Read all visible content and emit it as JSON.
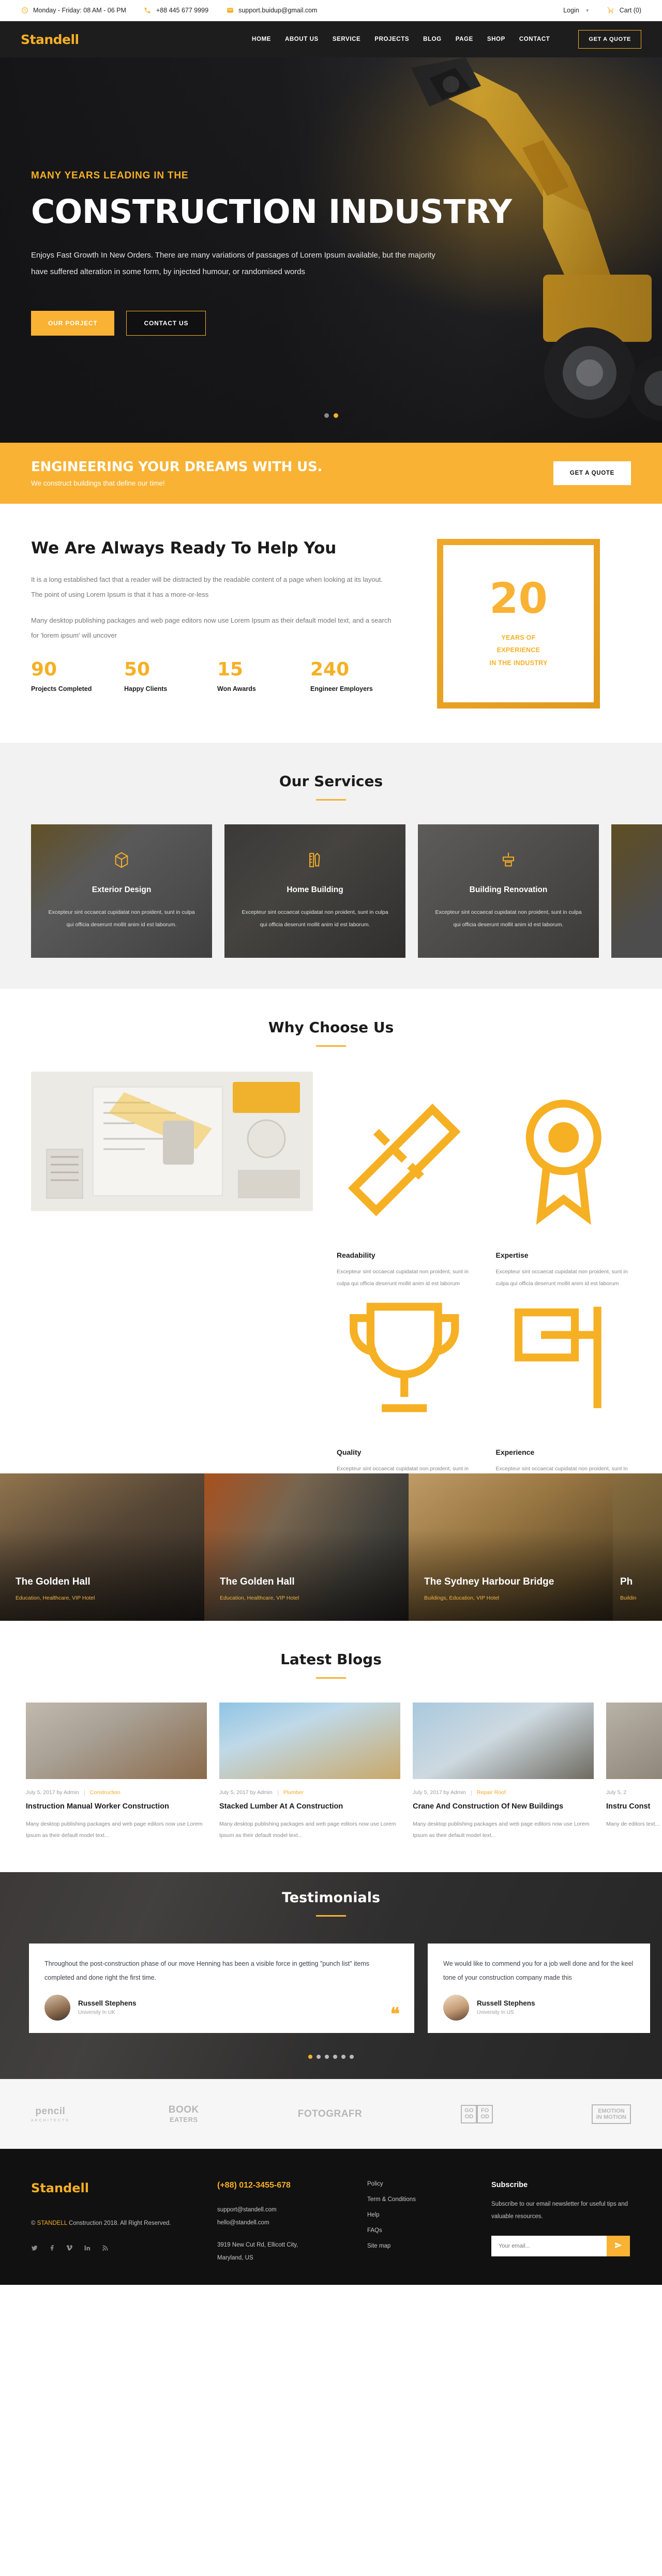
{
  "topbar": {
    "hours": "Monday - Friday: 08 AM - 06 PM",
    "phone": "+88 445 677 9999",
    "email": "support.buidup@gmail.com",
    "login": "Login",
    "cart": "Cart (0)"
  },
  "header": {
    "logo": "Standell",
    "nav": [
      "HOME",
      "ABOUT US",
      "SERVICE",
      "PROJECTS",
      "BLOG",
      "PAGE",
      "SHOP",
      "CONTACT"
    ],
    "quote_button": "GET A QUOTE"
  },
  "hero": {
    "kicker": "MANY YEARS LEADING IN THE",
    "title": "CONSTRUCTION INDUSTRY",
    "subtitle": "Enjoys Fast Growth In New Orders. There are many variations of passages of Lorem Ipsum available, but the majority have suffered alteration in some form, by injected humour, or randomised words",
    "primary_button": "OUR PORJECT",
    "secondary_button": "CONTACT US",
    "slides": 2,
    "active_slide": 1
  },
  "cta": {
    "title": "ENGINEERING YOUR DREAMS WITH US.",
    "subtitle": "We construct buildings that define our time!",
    "button": "GET A QUOTE"
  },
  "ready": {
    "title": "We Are Always Ready To Help You",
    "paragraph1": "It is a long established fact that a reader will be distracted by the readable content of a page when looking at its layout. The point of using Lorem Ipsum is that it has a more-or-less",
    "paragraph2": "Many desktop publishing packages and web page editors now use Lorem Ipsum as their default model text, and a search for 'lorem ipsum' will uncover",
    "stats": [
      {
        "number": "90",
        "label": "Projects Completed"
      },
      {
        "number": "50",
        "label": "Happy Clients"
      },
      {
        "number": "15",
        "label": "Won Awards"
      },
      {
        "number": "240",
        "label": "Engineer Employers"
      }
    ],
    "experience": {
      "number": "20",
      "line1": "YEARS OF",
      "line2": "EXPERIENCE",
      "line3": "IN THE INDUSTRY"
    }
  },
  "services": {
    "title": "Our Services",
    "items": [
      {
        "name": "Exterior Design",
        "desc": "Excepteur sint occaecat cupidatat non proident, sunt in culpa qui officia deserunt mollit anim id est laborum.",
        "icon": "box-icon"
      },
      {
        "name": "Home Building",
        "desc": "Excepteur sint occaecat cupidatat non proident, sunt in culpa qui officia deserunt mollit anim id est laborum.",
        "icon": "pencil-ruler-icon"
      },
      {
        "name": "Building Renovation",
        "desc": "Excepteur sint occaecat cupidatat non proident, sunt in culpa qui officia deserunt mollit anim id est laborum.",
        "icon": "paint-brush-icon"
      }
    ]
  },
  "why": {
    "title": "Why Choose Us",
    "features": [
      {
        "name": "Readability",
        "desc": "Excepteur sint occaecat cupidatat non proident, sunt in culpa qui officia deserunt mollit anim id est laborum",
        "icon": "ruler-icon"
      },
      {
        "name": "Expertise",
        "desc": "Excepteur sint occaecat cupidatat non proident, sunt in culpa qui officia deserunt mollit anim id est laborum",
        "icon": "badge-icon"
      },
      {
        "name": "Quality",
        "desc": "Excepteur sint occaecat cupidatat non proident, sunt in culpa qui officia deserunt mollit anim id est laborum",
        "icon": "trophy-icon"
      },
      {
        "name": "Experience",
        "desc": "Excepteur sint occaecat cupidatat non proident, sunt in culpa qui officia deserunt mollit anim id est laborum",
        "icon": "flag-icon"
      }
    ]
  },
  "projects": [
    {
      "title": "The Golden Hall",
      "tags": "Education, Healthcare, VIP Hotel"
    },
    {
      "title": "The Golden Hall",
      "tags": "Education, Healthcare, VIP Hotel"
    },
    {
      "title": "The Sydney Harbour Bridge",
      "tags": "Buildings, Education, VIP Hotel"
    },
    {
      "title": "Ph",
      "tags": "Buildin"
    }
  ],
  "blogs": {
    "title": "Latest Blogs",
    "posts": [
      {
        "date": "July 5, 2017 by Admin",
        "category": "Construction",
        "title": "Instruction Manual Worker Construction",
        "excerpt": "Many desktop publishing packages and web page editors now use Lorem Ipsum as their default model text..."
      },
      {
        "date": "July 5, 2017 by Admin",
        "category": "Plumber",
        "title": "Stacked Lumber At A Construction",
        "excerpt": "Many desktop publishing packages and web page editors now use Lorem Ipsum as their default model text..."
      },
      {
        "date": "July 5, 2017 by Admin",
        "category": "Repair Roof",
        "title": "Crane And Construction Of New Buildings",
        "excerpt": "Many desktop publishing packages and web page editors now use Lorem Ipsum as their default model text..."
      },
      {
        "date": "July 5, 2",
        "category": "",
        "title": "Instru Const",
        "excerpt": "Many de editors text..."
      }
    ]
  },
  "testimonials": {
    "title": "Testimonials",
    "items": [
      {
        "quote": "Throughout the post-construction phase of our move Henning has been a visible force in getting \"punch list\" items completed and done right the first time.",
        "name": "Russell Stephens",
        "role": "University In UK"
      },
      {
        "quote": "We would like to commend you for a job well done and for the keel tone of your construction company made this",
        "name": "Russell Stephens",
        "role": "University In US"
      }
    ],
    "dots": 6,
    "active_dot": 0
  },
  "partners": [
    {
      "name": "pencil",
      "sub": "ARCHITECTS"
    },
    {
      "name": "BOOK",
      "sub": "EATERS"
    },
    {
      "name": "FOTOGRAFR",
      "sub": ""
    },
    {
      "name": "GO FO OD OD",
      "sub": ""
    },
    {
      "name": "EMOTION IN MOTION",
      "sub": ""
    }
  ],
  "footer": {
    "logo": "Standell",
    "copyright_pre": "© ",
    "copyright_brand": "STANDELL",
    "copyright_post": " Construction 2018. All Right Reserved.",
    "socials": [
      "twitter-icon",
      "facebook-icon",
      "vimeo-icon",
      "linkedin-icon",
      "rss-icon"
    ],
    "phone": "(+88) 012-3455-678",
    "email1": "support@standell.com",
    "email2": "hello@standell.com",
    "address1": "3919 New Cut Rd, Ellicott City,",
    "address2": "Maryland, US",
    "links": [
      "Policy",
      "Term & Conditions",
      "Help",
      "FAQs",
      "Site map"
    ],
    "subscribe_title": "Subscribe",
    "subscribe_text": "Subscribe to our email newsletter for useful tips and valuable resources.",
    "subscribe_placeholder": "Your email..."
  },
  "colors": {
    "accent": "#f6b024",
    "accent_bright": "#f9b233",
    "dark": "#1d1d1d",
    "footer": "#111111"
  }
}
